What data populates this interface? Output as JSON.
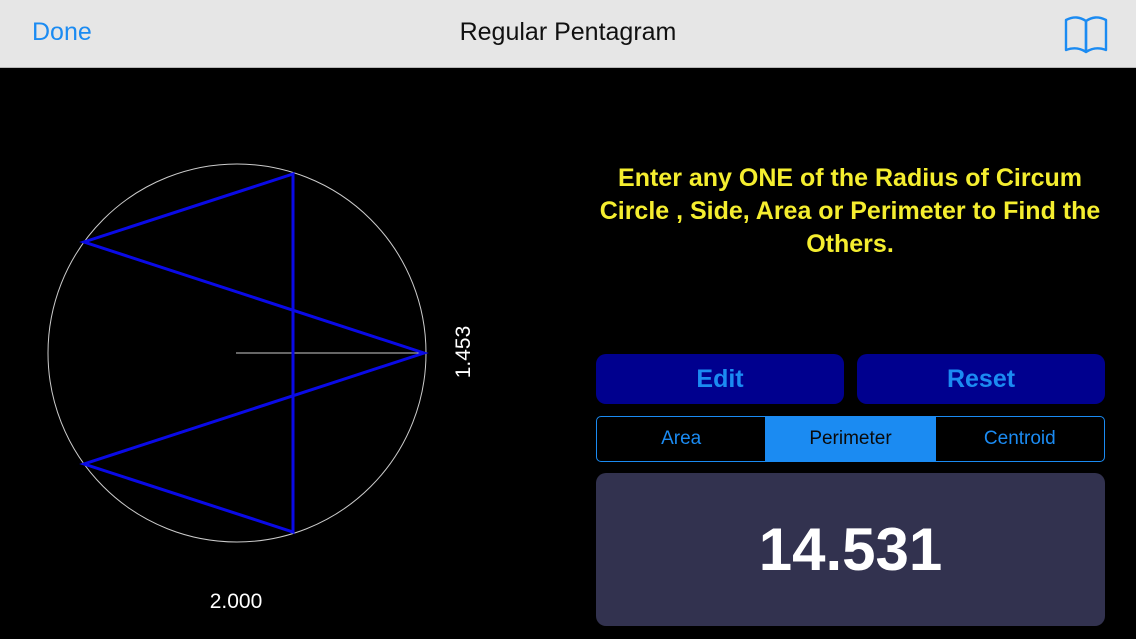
{
  "nav": {
    "done_label": "Done",
    "title": "Regular Pentagram",
    "book_icon": "book-icon"
  },
  "figure": {
    "side_label": "2.000",
    "radius_label": "1.453",
    "star_color": "#0a0ae6",
    "circle_color": "#cccccc"
  },
  "instructions": "Enter any ONE of the Radius of Circum Circle , Side, Area or Perimeter to Find the Others.",
  "buttons": {
    "edit_label": "Edit",
    "reset_label": "Reset"
  },
  "segments": [
    {
      "label": "Area",
      "selected": false
    },
    {
      "label": "Perimeter",
      "selected": true
    },
    {
      "label": "Centroid",
      "selected": false
    }
  ],
  "result_value": "14.531",
  "colors": {
    "accent": "#1b8bf2",
    "button_bg": "#00008e",
    "instruction_text": "#f5ee2f",
    "result_bg": "#32324f"
  }
}
